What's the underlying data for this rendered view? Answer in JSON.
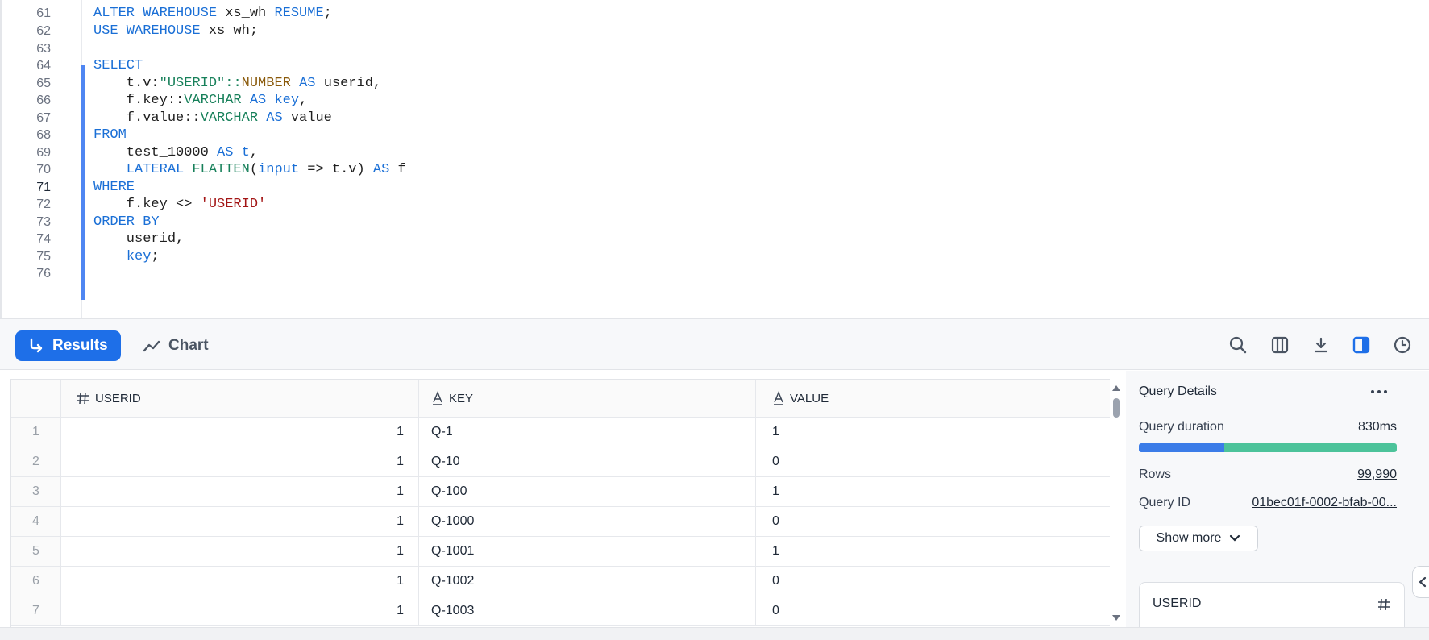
{
  "editor": {
    "lines": [
      {
        "n": "61",
        "code": [
          {
            "t": "ALTER WAREHOUSE ",
            "c": "kw"
          },
          {
            "t": "xs_wh ",
            "c": ""
          },
          {
            "t": "RESUME",
            "c": "kw"
          },
          {
            "t": ";",
            "c": ""
          }
        ]
      },
      {
        "n": "62",
        "code": [
          {
            "t": "USE WAREHOUSE ",
            "c": "kw"
          },
          {
            "t": "xs_wh;",
            "c": ""
          }
        ]
      },
      {
        "n": "63",
        "code": []
      },
      {
        "n": "64",
        "code": [
          {
            "t": "SELECT",
            "c": "kw"
          }
        ]
      },
      {
        "n": "65",
        "code": [
          {
            "t": "    t.v:",
            "c": ""
          },
          {
            "t": "\"USERID\"",
            "c": "fn"
          },
          {
            "t": "::",
            "c": "fn"
          },
          {
            "t": "NUMBER",
            "c": "ty"
          },
          {
            "t": " AS ",
            "c": "kw"
          },
          {
            "t": "userid,",
            "c": ""
          }
        ]
      },
      {
        "n": "66",
        "code": [
          {
            "t": "    f.key::",
            "c": ""
          },
          {
            "t": "VARCHAR",
            "c": "fn"
          },
          {
            "t": " AS ",
            "c": "kw"
          },
          {
            "t": "key",
            "c": "kw"
          },
          {
            "t": ",",
            "c": ""
          }
        ]
      },
      {
        "n": "67",
        "code": [
          {
            "t": "    f.value::",
            "c": ""
          },
          {
            "t": "VARCHAR",
            "c": "fn"
          },
          {
            "t": " AS ",
            "c": "kw"
          },
          {
            "t": "value",
            "c": ""
          }
        ]
      },
      {
        "n": "68",
        "code": [
          {
            "t": "FROM",
            "c": "kw"
          }
        ]
      },
      {
        "n": "69",
        "code": [
          {
            "t": "    test_10000 ",
            "c": ""
          },
          {
            "t": "AS ",
            "c": "kw"
          },
          {
            "t": "t",
            "c": "kw"
          },
          {
            "t": ",",
            "c": ""
          }
        ]
      },
      {
        "n": "70",
        "code": [
          {
            "t": "    LATERAL ",
            "c": "kw"
          },
          {
            "t": "FLATTEN",
            "c": "fn"
          },
          {
            "t": "(",
            "c": ""
          },
          {
            "t": "input",
            "c": "kw"
          },
          {
            "t": " => t.v) ",
            "c": ""
          },
          {
            "t": "AS ",
            "c": "kw"
          },
          {
            "t": "f",
            "c": ""
          }
        ]
      },
      {
        "n": "71",
        "code": [
          {
            "t": "WHERE",
            "c": "kw"
          }
        ]
      },
      {
        "n": "72",
        "code": [
          {
            "t": "    f.key <> ",
            "c": ""
          },
          {
            "t": "'USERID'",
            "c": "str"
          }
        ]
      },
      {
        "n": "73",
        "code": [
          {
            "t": "ORDER BY",
            "c": "kw"
          }
        ]
      },
      {
        "n": "74",
        "code": [
          {
            "t": "    userid,",
            "c": ""
          }
        ]
      },
      {
        "n": "75",
        "code": [
          {
            "t": "    ",
            "c": ""
          },
          {
            "t": "key",
            "c": "kw"
          },
          {
            "t": ";",
            "c": ""
          }
        ]
      },
      {
        "n": "76",
        "code": []
      }
    ],
    "active_line": "71"
  },
  "toolbar": {
    "results_label": "Results",
    "chart_label": "Chart",
    "icons": [
      "search-icon",
      "columns-icon",
      "download-icon",
      "split-panel-icon",
      "history-icon"
    ],
    "accent": "#1e6fe8"
  },
  "grid": {
    "columns": [
      {
        "label": "USERID",
        "type_icon": "hash-icon"
      },
      {
        "label": "KEY",
        "type_icon": "text-type-icon"
      },
      {
        "label": "VALUE",
        "type_icon": "text-type-icon"
      }
    ],
    "rows": [
      {
        "idx": "1",
        "userid": "1",
        "key": "Q-1",
        "value": "1"
      },
      {
        "idx": "2",
        "userid": "1",
        "key": "Q-10",
        "value": "0"
      },
      {
        "idx": "3",
        "userid": "1",
        "key": "Q-100",
        "value": "1"
      },
      {
        "idx": "4",
        "userid": "1",
        "key": "Q-1000",
        "value": "0"
      },
      {
        "idx": "5",
        "userid": "1",
        "key": "Q-1001",
        "value": "1"
      },
      {
        "idx": "6",
        "userid": "1",
        "key": "Q-1002",
        "value": "0"
      },
      {
        "idx": "7",
        "userid": "1",
        "key": "Q-1003",
        "value": "0"
      }
    ]
  },
  "details": {
    "title": "Query Details",
    "duration_label": "Query duration",
    "duration_value": "830ms",
    "duration_split": [
      0.33,
      0.67
    ],
    "duration_colors": [
      "#3b7ce8",
      "#4cc39a"
    ],
    "rows_label": "Rows",
    "rows_value": "99,990",
    "query_id_label": "Query ID",
    "query_id_value": "01bec01f-0002-bfab-00...",
    "show_more_label": "Show more",
    "column_card_label": "USERID"
  }
}
